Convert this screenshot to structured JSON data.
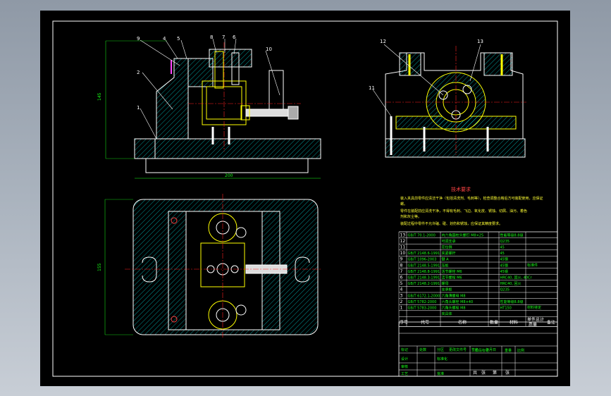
{
  "drawing": {
    "callouts_front": [
      "9",
      "4",
      "5",
      "8",
      "7",
      "6",
      "10",
      "2",
      "1"
    ],
    "callouts_side": [
      "12",
      "13",
      "11"
    ],
    "dim_front_width": "200",
    "dim_front_height": "145",
    "dim_plan_height": "155",
    "tech_req_title": "技术要求",
    "tech_req_lines": [
      "装入夹具前零件应清洁干净（包括清洗剂、毛刺等），检查调整合格后方可装配使用，应保证",
      "螺。",
      "零件在装配前应清洗干净，不得有毛刺、飞边、氧化皮、锈蚀、切屑、油污、着色",
      "剂和灰尘等。",
      "装配过程中零件不允许磕、碰、划伤和锈蚀，应保证其精度要求。"
    ]
  },
  "bom": {
    "rows": [
      {
        "no": "13",
        "code": "GB/T 70.1-2000",
        "name": "内六角圆柱头螺钉 M8×25",
        "qty": "",
        "mat": "性能等级8.8级"
      },
      {
        "no": "12",
        "code": "",
        "name": "可调支承",
        "qty": "",
        "mat": "Q235"
      },
      {
        "no": "11",
        "code": "",
        "name": "定位销",
        "qty": "",
        "mat": "45"
      },
      {
        "no": "10",
        "code": "GB/T 2148.6-1991",
        "name": "夹紧螺杆",
        "qty": "",
        "mat": "45"
      },
      {
        "no": "9",
        "code": "GB/T 1096-2003",
        "name": "键 A",
        "qty": "",
        "mat": "45钢"
      },
      {
        "no": "8",
        "code": "GB/T 2148.5-1991",
        "name": "压板",
        "qty": "",
        "mat": "45钢"
      },
      {
        "no": "7",
        "code": "GB/T 2148.8-1991",
        "name": "活节螺栓 M6",
        "qty": "",
        "mat": "45钢"
      },
      {
        "no": "6",
        "code": "GB/T 2148.3-1991",
        "name": "活节螺栓 M6",
        "qty": "",
        "mat": "HRC40, 回火, 40Cr"
      },
      {
        "no": "5",
        "code": "GB/T 2148.2-1991",
        "name": "螺母",
        "qty": "",
        "mat": "HRC40, 回火"
      },
      {
        "no": "4",
        "code": "",
        "name": "支承板",
        "qty": "",
        "mat": "Q235"
      },
      {
        "no": "3",
        "code": "GB/T 6172.1-2000",
        "name": "六角薄螺母 M8",
        "qty": "",
        "mat": ""
      },
      {
        "no": "2",
        "code": "GB/T 5782-2000",
        "name": "六角头螺栓 M8×40",
        "qty": "",
        "mat": "性能等级8.8级"
      },
      {
        "no": "1",
        "code": "GB/T 5783-2000",
        "name": "六角头螺栓 M8",
        "qty": "",
        "mat": "HT150"
      },
      {
        "no": "",
        "code": "",
        "name": "夹具体",
        "qty": "",
        "mat": ""
      }
    ],
    "header": {
      "no": "序号",
      "code": "代号",
      "name": "名称",
      "qty": "数量",
      "mat": "材料",
      "unit": "单件",
      "total": "总计",
      "weight": "质量",
      "remark": "备注"
    },
    "side_note_1": "标准件",
    "side_note_2": "材料待定"
  },
  "titleblock": {
    "labels": [
      "标记",
      "处数",
      "分区",
      "更改文件号",
      "签名",
      "年月日",
      "设计",
      "标准化",
      "审核",
      "工艺",
      "批准",
      "阶段标记",
      "重量",
      "比例",
      "共",
      "张",
      "第",
      "张"
    ]
  },
  "colors": {
    "sheet": "#000000",
    "outline": "#ffffff",
    "part": "#ffff00",
    "center": "#ff2222",
    "hatch": "#00ffff",
    "dim": "#19ff19",
    "bolt": "#ff44ff"
  }
}
